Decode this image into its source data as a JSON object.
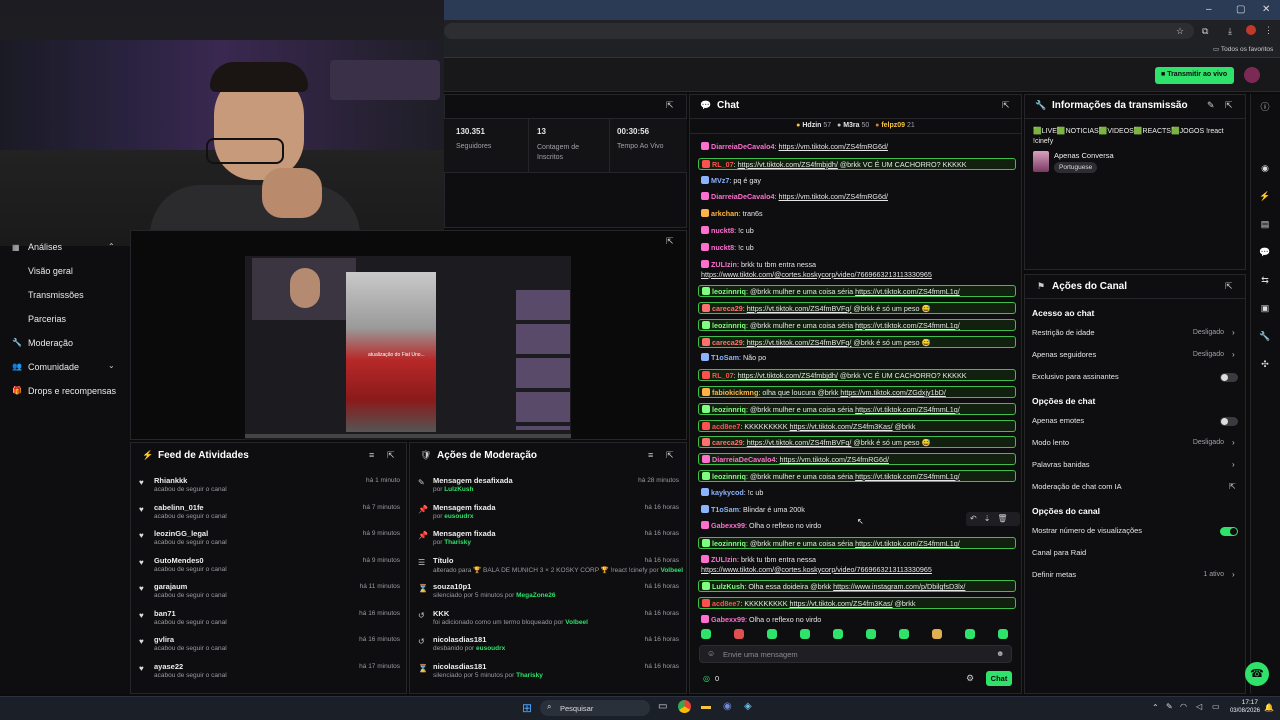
{
  "browser": {
    "bookmarks_label": "Todos os favoritos"
  },
  "header": {
    "go_live_label": "Transmitir ao vivo"
  },
  "stats": [
    {
      "value": "130.351",
      "label": "Seguidores"
    },
    {
      "value": "13",
      "label": "Contagem de Inscritos"
    },
    {
      "value": "00:30:56",
      "label": "Tempo Ao Vivo"
    }
  ],
  "sidenav": {
    "items": [
      "Análises",
      "Visão geral",
      "Transmissões",
      "Parcerias",
      "Moderação",
      "Comunidade",
      "Drops e recompensas"
    ]
  },
  "video": {
    "overlay_text": "atualização do Fiat Uno..."
  },
  "activity_feed": {
    "title": "Feed de Atividades",
    "items": [
      {
        "name": "Rhiankkk",
        "action": "acabou de seguir o canal",
        "time": "há 1 minuto"
      },
      {
        "name": "cabelinn_01fe",
        "action": "acabou de seguir o canal",
        "time": "há 7 minutos"
      },
      {
        "name": "leozinGG_legal",
        "action": "acabou de seguir o canal",
        "time": "há 9 minutos"
      },
      {
        "name": "GutoMendes0",
        "action": "acabou de seguir o canal",
        "time": "há 9 minutos"
      },
      {
        "name": "garajaum",
        "action": "acabou de seguir o canal",
        "time": "há 11 minutos"
      },
      {
        "name": "ban71",
        "action": "acabou de seguir o canal",
        "time": "há 16 minutos"
      },
      {
        "name": "gvlira",
        "action": "acabou de seguir o canal",
        "time": "há 16 minutos"
      },
      {
        "name": "ayase22",
        "action": "acabou de seguir o canal",
        "time": "há 17 minutos"
      }
    ]
  },
  "moderation": {
    "title": "Ações de Moderação",
    "items": [
      {
        "title": "Mensagem desafixada",
        "sub": "por ",
        "who": "LulzKush",
        "time": "há 28 minutos",
        "icon": "unpin-icon",
        "glyph": "✎"
      },
      {
        "title": "Mensagem fixada",
        "sub": "por ",
        "who": "eusoudrx",
        "time": "há 16 horas",
        "icon": "pin-icon",
        "glyph": "📌"
      },
      {
        "title": "Mensagem fixada",
        "sub": "por ",
        "who": "Tharisky",
        "time": "há 16 horas",
        "icon": "pin-icon",
        "glyph": "📌"
      },
      {
        "title": "Título",
        "sub": "alterado para 🏆 BALA DE MUNICH 3 × 2 KOSKY CORP 🏆 !react !cinefy por ",
        "who": "Volbeel",
        "time": "há 16 horas",
        "icon": "title-icon",
        "glyph": "☰"
      },
      {
        "title": "souza10p1",
        "sub": "silenciado por 5 minutos por ",
        "who": "MegaZone26",
        "time": "há 16 horas",
        "icon": "hourglass-icon",
        "glyph": "⌛"
      },
      {
        "title": "KKK",
        "sub": "foi adicionado como um termo bloqueado por ",
        "who": "Volbeel",
        "time": "há 16 horas",
        "icon": "undo-icon",
        "glyph": "↺"
      },
      {
        "title": "nicolasdias181",
        "sub": "desbanido por ",
        "who": "eusoudrx",
        "time": "há 16 horas",
        "icon": "undo-icon",
        "glyph": "↺"
      },
      {
        "title": "nicolasdias181",
        "sub": "silenciado por 5 minutos por ",
        "who": "Tharisky",
        "time": "há 16 horas",
        "icon": "hourglass-icon",
        "glyph": "⌛"
      }
    ]
  },
  "chat": {
    "title": "Chat",
    "top_gifters": [
      {
        "name": "Hdzin",
        "count": "57"
      },
      {
        "name": "M3ra",
        "count": "50"
      },
      {
        "name": "felpz09",
        "count": "21"
      }
    ],
    "messages": [
      {
        "user": "DiarreiaDeCavalo4",
        "color": "#ff6fd0",
        "text": "",
        "link": "https://vm.tiktok.com/ZS4fmRG6d/",
        "hl": false
      },
      {
        "user": "RL_07",
        "color": "#ff5050",
        "text": "",
        "link": "https://vt.tiktok.com/ZS4fmbjdh/",
        "after": " @brkk VC É UM CACHORRO? KKKKK",
        "hl": true
      },
      {
        "user": "MVz7",
        "color": "#8ab4ff",
        "text": "pq é gay",
        "hl": false
      },
      {
        "user": "DiarreiaDeCavalo4",
        "color": "#ff6fd0",
        "text": "",
        "link": "https://vm.tiktok.com/ZS4fmRG6d/",
        "hl": false
      },
      {
        "user": "arkchan",
        "color": "#ffb347",
        "text": "tran6s",
        "hl": false
      },
      {
        "user": "nuckt8",
        "color": "#ff6fd0",
        "text": "!c ub",
        "hl": false
      },
      {
        "user": "nuckt8",
        "color": "#ff6fd0",
        "text": "!c ub",
        "hl": false
      },
      {
        "user": "ZULIzin",
        "color": "#ff6fd0",
        "text": "brkk tu tbm entra nessa",
        "link2": "https://www.tiktok.com/@cortes.koskycorp/video/7669663213113330965",
        "hl": false
      },
      {
        "user": "leozinnriq",
        "color": "#7fff7f",
        "text": "@brkk mulher e uma coisa séria ",
        "link": "https://vt.tiktok.com/ZS4fmmL1q/",
        "hl": true
      },
      {
        "user": "careca29",
        "color": "#ff7070",
        "text": "",
        "link": "https://vt.tiktok.com/ZS4fmBVFq/",
        "after": " @brkk é só um peso 😅",
        "hl": true
      },
      {
        "user": "leozinnriq",
        "color": "#7fff7f",
        "text": "@brkk mulher e uma coisa séria ",
        "link": "https://vt.tiktok.com/ZS4fmmL1q/",
        "hl": true
      },
      {
        "user": "careca29",
        "color": "#ff7070",
        "text": "",
        "link": "https://vt.tiktok.com/ZS4fmBVFq/",
        "after": " @brkk é só um peso 😅",
        "hl": true
      },
      {
        "user": "T1oSam",
        "color": "#8ab4ff",
        "text": "Não po",
        "hl": false
      },
      {
        "user": "RL_07",
        "color": "#ff5050",
        "text": "",
        "link": "https://vt.tiktok.com/ZS4fmbjdh/",
        "after": " @brkk VC É UM CACHORRO? KKKKK",
        "hl": true
      },
      {
        "user": "fabiokickmng",
        "color": "#ffb347",
        "text": "olha que loucura @brkk ",
        "link": "https://vm.tiktok.com/ZGdxjy1bD/",
        "hl": true
      },
      {
        "user": "leozinnriq",
        "color": "#7fff7f",
        "text": "@brkk mulher e uma coisa séria ",
        "link": "https://vt.tiktok.com/ZS4fmmL1q/",
        "hl": true
      },
      {
        "user": "acd8ee7",
        "color": "#ff5050",
        "text": "KKKKKKKKK ",
        "link": "https://vt.tiktok.com/ZS4fm3Kas/",
        "after": " @brkk",
        "hl": true
      },
      {
        "user": "careca29",
        "color": "#ff7070",
        "text": "",
        "link": "https://vt.tiktok.com/ZS4fmBVFq/",
        "after": " @brkk é só um peso 😅",
        "hl": true
      },
      {
        "user": "DiarreiaDeCavalo4",
        "color": "#ff6fd0",
        "text": "",
        "link": "https://vm.tiktok.com/ZS4fmRG6d/",
        "hl": true
      },
      {
        "user": "leozinnriq",
        "color": "#7fff7f",
        "text": "@brkk mulher e uma coisa séria ",
        "link": "https://vt.tiktok.com/ZS4fmmL1q/",
        "hl": true
      },
      {
        "user": "kaykycod",
        "color": "#8ab4ff",
        "text": "!c ub",
        "hl": false
      },
      {
        "user": "T1oSam",
        "color": "#8ab4ff",
        "text": "Blindar é uma 200k",
        "hl": false
      },
      {
        "user": "Gabexx99",
        "color": "#ff6fd0",
        "text": "Olha o reflexo no virdo",
        "hl": false
      },
      {
        "user": "leozinnriq",
        "color": "#7fff7f",
        "text": "@brkk mulher e uma coisa séria ",
        "link": "https://vt.tiktok.com/ZS4fmmL1q/",
        "hl": true
      },
      {
        "user": "ZULIzin",
        "color": "#ff6fd0",
        "text": "brkk tu tbm entra nessa",
        "link2": "https://www.tiktok.com/@cortes.koskycorp/video/7669663213113330965",
        "hl": false
      },
      {
        "user": "LulzKush",
        "color": "#7fff7f",
        "text": "Olha essa doideira @brkk ",
        "link": "https://www.instagram.com/p/DbilgfsD3lx/",
        "hl": true
      },
      {
        "user": "acd8ee7",
        "color": "#ff5050",
        "text": "KKKKKKKKK ",
        "link": "https://vt.tiktok.com/ZS4fm3Kas/",
        "after": " @brkk",
        "hl": true
      },
      {
        "user": "Gabexx99",
        "color": "#ff6fd0",
        "text": "Olha o reflexo no virdo",
        "hl": false
      }
    ],
    "input_placeholder": "Envie uma mensagem",
    "points": "0",
    "send_label": "Chat"
  },
  "stream_info": {
    "title": "Informações da transmissão",
    "stream_title": "🟩LIVE🟩NOTICIAS🟩VIDEOS🟩REACTS🟩JOGOS !react !cinefy",
    "category": "Apenas Conversa",
    "language": "Portuguese"
  },
  "channel_actions": {
    "title": "Ações do Canal",
    "sections": [
      {
        "heading": "Acesso ao chat",
        "rows": [
          {
            "label": "Restrição de idade",
            "value": "Desligado",
            "control": "chevron"
          },
          {
            "label": "Apenas seguidores",
            "value": "Desligado",
            "control": "chevron"
          },
          {
            "label": "Exclusivo para assinantes",
            "value": "",
            "control": "toggle-off"
          }
        ]
      },
      {
        "heading": "Opções de chat",
        "rows": [
          {
            "label": "Apenas emotes",
            "value": "",
            "control": "toggle-off"
          },
          {
            "label": "Modo lento",
            "value": "Desligado",
            "control": "chevron"
          },
          {
            "label": "Palavras banidas",
            "value": "",
            "control": "chevron"
          },
          {
            "label": "Moderação de chat com IA",
            "value": "",
            "control": "external"
          }
        ]
      },
      {
        "heading": "Opções do canal",
        "rows": [
          {
            "label": "Mostrar número de visualizações",
            "value": "",
            "control": "toggle-on"
          },
          {
            "label": "Canal para Raid",
            "value": "",
            "control": "none"
          },
          {
            "label": "Definir metas",
            "value": "1 ativo",
            "control": "chevron"
          }
        ]
      }
    ]
  },
  "taskbar": {
    "search_placeholder": "Pesquisar",
    "time": "17:17",
    "date": "03/08/2026"
  },
  "colors": {
    "accent": "#2ee26a",
    "panel": "#0e0e10",
    "border": "#26262a"
  }
}
